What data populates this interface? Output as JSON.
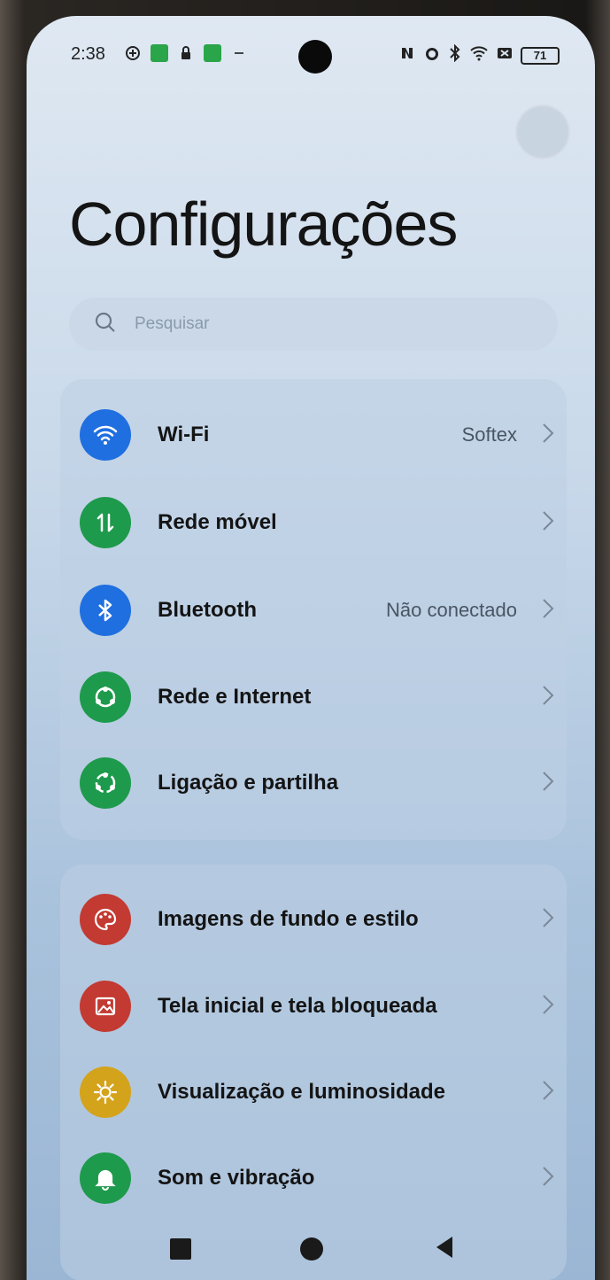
{
  "status": {
    "time": "2:38",
    "battery": "71"
  },
  "page": {
    "title": "Configurações"
  },
  "search": {
    "placeholder": "Pesquisar"
  },
  "group1": [
    {
      "label": "Wi-Fi",
      "value": "Softex",
      "icon": "wifi-icon",
      "color": "#1f6fe0"
    },
    {
      "label": "Rede móvel",
      "value": "",
      "icon": "mobile-data-icon",
      "color": "#1e9a4c"
    },
    {
      "label": "Bluetooth",
      "value": "Não conectado",
      "icon": "bluetooth-icon",
      "color": "#1f6fe0"
    },
    {
      "label": "Rede e Internet",
      "value": "",
      "icon": "network-icon",
      "color": "#1e9a4c"
    },
    {
      "label": "Ligação e partilha",
      "value": "",
      "icon": "share-icon",
      "color": "#1e9a4c"
    }
  ],
  "group2": [
    {
      "label": "Imagens de fundo e estilo",
      "value": "",
      "icon": "palette-icon",
      "color": "#c33a32"
    },
    {
      "label": "Tela inicial e tela bloqueada",
      "value": "",
      "icon": "image-icon",
      "color": "#c33a32"
    },
    {
      "label": "Visualização e luminosidade",
      "value": "",
      "icon": "brightness-icon",
      "color": "#d4a31c"
    },
    {
      "label": "Som e vibração",
      "value": "",
      "icon": "bell-icon",
      "color": "#1e9a4c"
    }
  ],
  "nav": {
    "recents": "recents-icon",
    "home": "home-icon",
    "back": "back-icon"
  }
}
